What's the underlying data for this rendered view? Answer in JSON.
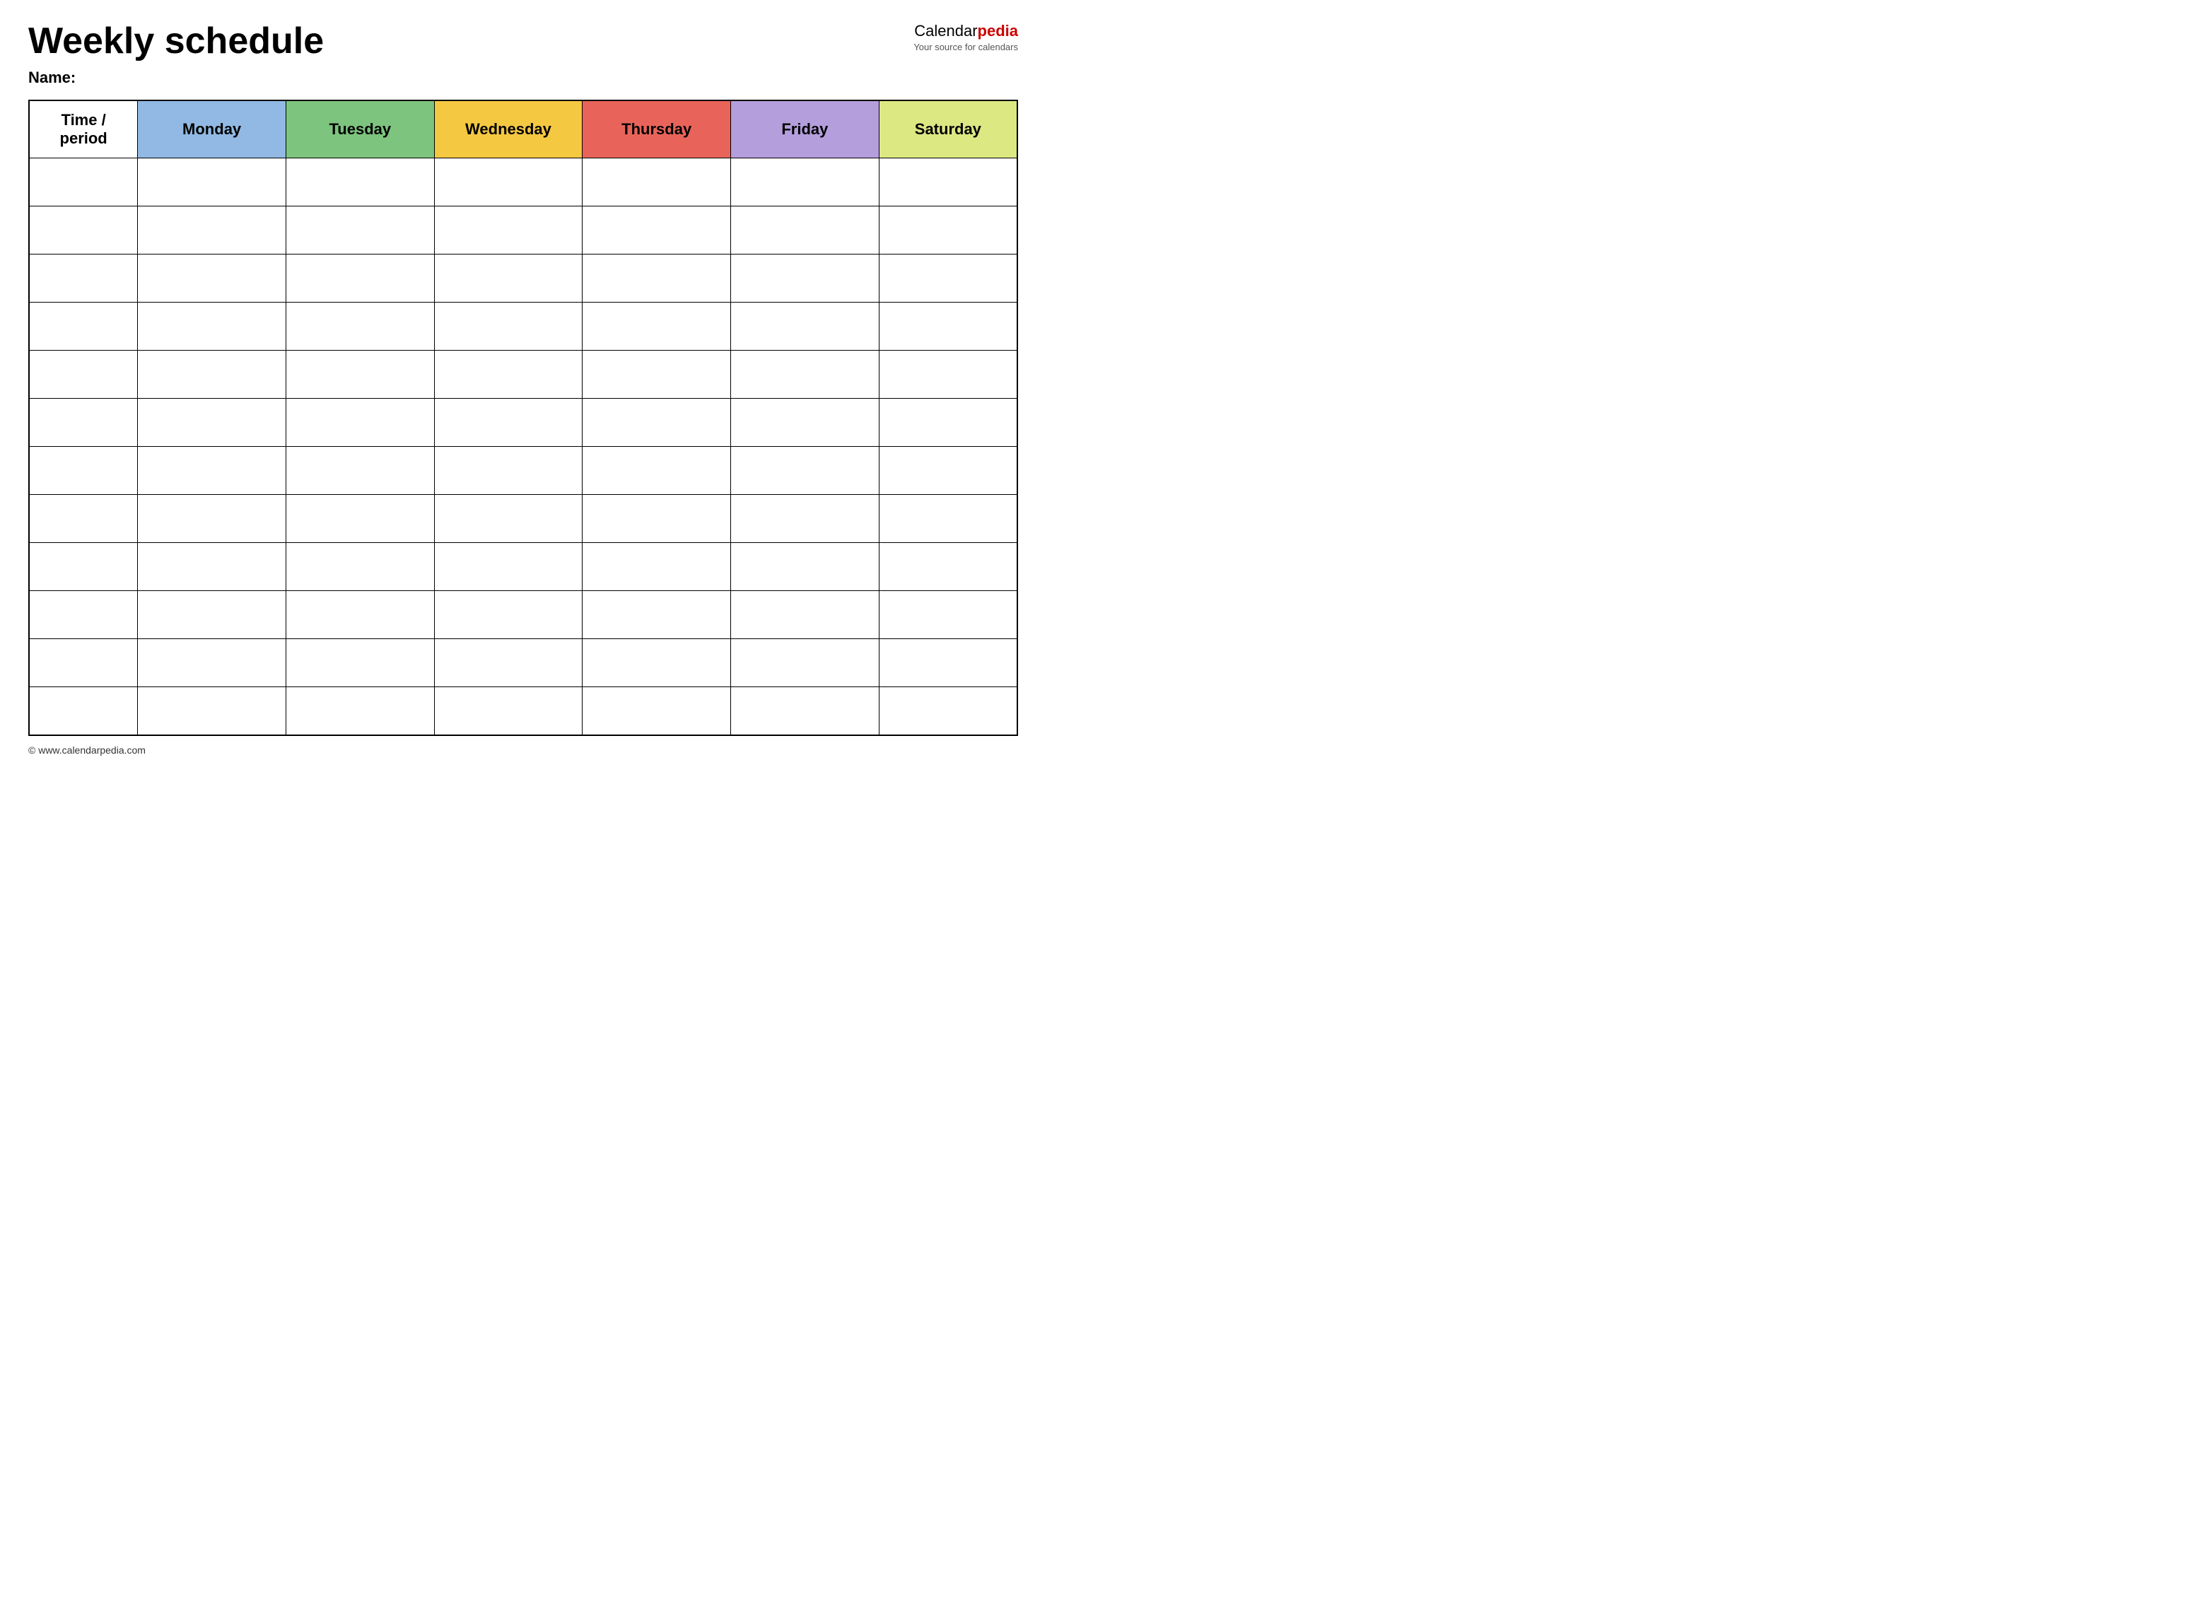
{
  "header": {
    "title": "Weekly schedule",
    "name_label": "Name:",
    "logo_text_calendar": "Calendar",
    "logo_text_pedia": "pedia",
    "logo_tagline": "Your source for calendars"
  },
  "table": {
    "columns": [
      {
        "id": "time",
        "label": "Time / period",
        "class": "th-time"
      },
      {
        "id": "monday",
        "label": "Monday",
        "class": "th-monday"
      },
      {
        "id": "tuesday",
        "label": "Tuesday",
        "class": "th-tuesday"
      },
      {
        "id": "wednesday",
        "label": "Wednesday",
        "class": "th-wednesday"
      },
      {
        "id": "thursday",
        "label": "Thursday",
        "class": "th-thursday"
      },
      {
        "id": "friday",
        "label": "Friday",
        "class": "th-friday"
      },
      {
        "id": "saturday",
        "label": "Saturday",
        "class": "th-saturday"
      }
    ],
    "row_count": 12
  },
  "footer": {
    "url": "© www.calendarpedia.com"
  }
}
